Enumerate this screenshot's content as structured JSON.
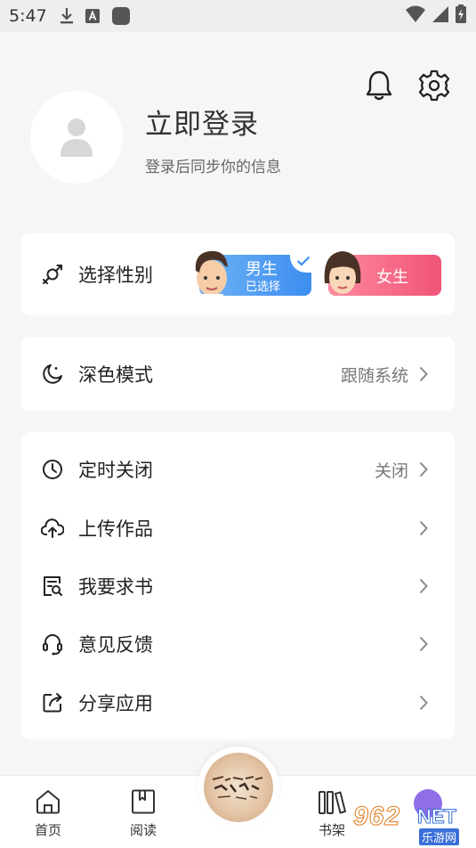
{
  "status_bar": {
    "time": "5:47",
    "left_icons": [
      "download-icon",
      "a-notification-icon",
      "app-square-icon"
    ],
    "right_icons": [
      "wifi-icon",
      "signal-icon",
      "battery-charging-icon"
    ]
  },
  "header": {
    "login_title": "立即登录",
    "login_subtitle": "登录后同步你的信息",
    "icons": [
      "bell-icon",
      "gear-icon"
    ]
  },
  "gender": {
    "label": "选择性别",
    "male": {
      "label": "男生",
      "sub": "已选择",
      "selected": true
    },
    "female": {
      "label": "女生"
    }
  },
  "dark_mode": {
    "label": "深色模式",
    "value": "跟随系统"
  },
  "menu": [
    {
      "label": "定时关闭",
      "value": "关闭",
      "icon": "clock-icon"
    },
    {
      "label": "上传作品",
      "value": "",
      "icon": "cloud-upload-icon"
    },
    {
      "label": "我要求书",
      "value": "",
      "icon": "book-search-icon"
    },
    {
      "label": "意见反馈",
      "value": "",
      "icon": "headset-icon"
    },
    {
      "label": "分享应用",
      "value": "",
      "icon": "share-icon"
    }
  ],
  "bottom_nav": [
    {
      "label": "首页",
      "icon": "home-icon"
    },
    {
      "label": "阅读",
      "icon": "book-open-icon"
    },
    {
      "label": "书架",
      "icon": "bookshelf-icon"
    }
  ],
  "watermark": {
    "num": "962",
    "net": "NET",
    "cn": "乐游网"
  },
  "colors": {
    "male_blue": "#3d8ef0",
    "female_pink": "#ef5476",
    "background": "#f6f6f6",
    "fab_purple": "#8f6ee8"
  }
}
